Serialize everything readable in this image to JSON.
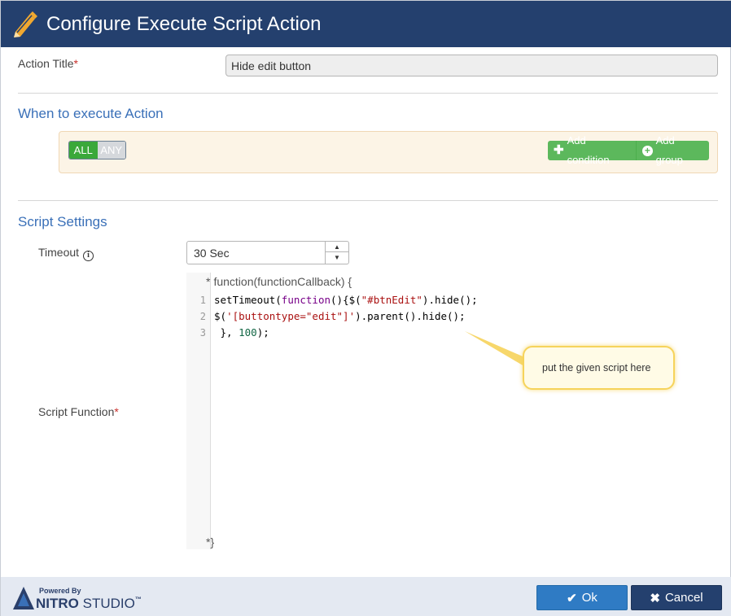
{
  "dialog": {
    "title": "Configure Execute Script Action",
    "icon": "pencil-icon"
  },
  "action_title": {
    "label": "Action Title",
    "required_mark": "*",
    "value": "Hide edit button"
  },
  "when_section": {
    "title": "When to execute Action",
    "toggle_all": "ALL",
    "toggle_any": "ANY",
    "toggle_selected": "ALL",
    "add_condition_label": "Add condition",
    "add_group_label": "Add group"
  },
  "script_section": {
    "title": "Script Settings",
    "timeout_label": "Timeout",
    "timeout_value": "30 Sec",
    "script_function_label": "Script Function",
    "required_mark": "*",
    "code_header_star": "*",
    "code_header": "function(functionCallback) {",
    "code_footer_star": "*",
    "code_footer": "}",
    "line_numbers": [
      "1",
      "2",
      "3"
    ],
    "code_lines": [
      "setTimeout(function(){$(\"#btnEdit\").hide();",
      "$('[buttontype=\"edit\"]').parent().hide();",
      " }, 100);"
    ]
  },
  "callout": {
    "text": "put the given script here"
  },
  "footer": {
    "powered_by": "Powered By",
    "brand_nitro": "NITRO",
    "brand_studio": "STUDIO",
    "trademark": "™",
    "ok_label": "Ok",
    "cancel_label": "Cancel"
  },
  "colors": {
    "header_bg": "#24406e",
    "accent_blue": "#3a70b8",
    "green": "#5cb85c",
    "ok_blue": "#2f7bc4"
  }
}
